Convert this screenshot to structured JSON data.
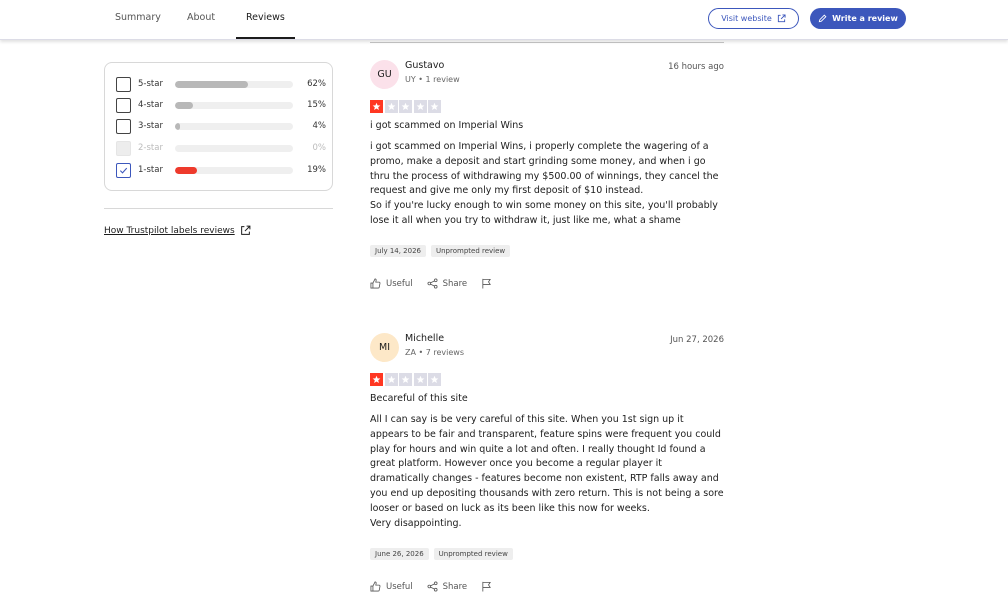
{
  "nav": {
    "tabs": [
      "Summary",
      "About",
      "Reviews"
    ],
    "active_tab": "Reviews",
    "visit_label": "Visit website",
    "write_label": "Write a review"
  },
  "filters": {
    "rows": [
      {
        "label": "5-star",
        "percent": "62%",
        "fraction": 0.62,
        "checked": false,
        "disabled": false
      },
      {
        "label": "4-star",
        "percent": "15%",
        "fraction": 0.15,
        "checked": false,
        "disabled": false
      },
      {
        "label": "3-star",
        "percent": "4%",
        "fraction": 0.04,
        "checked": false,
        "disabled": false
      },
      {
        "label": "2-star",
        "percent": "0%",
        "fraction": 0.0,
        "checked": false,
        "disabled": true
      },
      {
        "label": "1-star",
        "percent": "19%",
        "fraction": 0.19,
        "checked": true,
        "disabled": false
      }
    ],
    "labels_link": "How Trustpilot labels reviews"
  },
  "reviews": [
    {
      "initials": "GU",
      "avatar_color": "#fbe1ea",
      "name": "Gustavo",
      "meta": "UY • 1 review",
      "date": "16 hours ago",
      "stars": 1,
      "title": "i got scammed on Imperial Wins",
      "body": "i got scammed on Imperial Wins, i properly complete the wagering of a promo, make a deposit and start grinding some money, and when i go thru the process of withdrawing my $500.00 of winnings, they cancel the request and give me only my first deposit of $10 instead.\nSo if you're lucky enough to win some money on this site, you'll probably lose it all when you try to withdraw it, just like me, what a shame",
      "experience_date": "July 14, 2026",
      "label": "Unprompted review",
      "useful": "Useful",
      "share": "Share"
    },
    {
      "initials": "MI",
      "avatar_color": "#fde8c8",
      "name": "Michelle",
      "meta": "ZA • 7 reviews",
      "date": "Jun 27, 2026",
      "stars": 1,
      "title": "Becareful of this site",
      "body": "All I can say is be very careful of this site. When you 1st sign up it appears to be fair and transparent, feature spins were frequent you could play for hours and win quite a lot and often. I really thought Id found a great platform. However once you become a regular player it dramatically changes - features become non existent, RTP falls away and you end up depositing thousands with zero return. This is not being a sore looser or based on luck as its been like this now for weeks.\nVery disappointing.",
      "experience_date": "June 26, 2026",
      "label": "Unprompted review",
      "useful": "Useful",
      "share": "Share"
    }
  ],
  "colors": {
    "brand_blue": "#3c57bc",
    "star_red": "#ff3722",
    "bar_red": "#ee3a2c"
  }
}
